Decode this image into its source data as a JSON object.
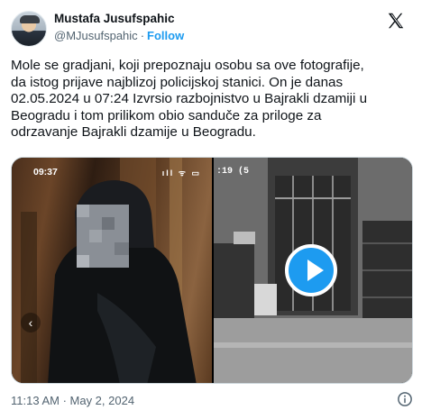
{
  "author": {
    "name": "Mustafa Jusufspahic",
    "handle": "@MJusufspahic",
    "separator": "·",
    "follow_label": "Follow"
  },
  "logo": "x-logo-icon",
  "tweet": {
    "text": "Mole se gradjani, koji prepoznaju osobu sa ove fotografije,\nda istog prijave najblizoj policijskoj stanici. On je danas\n02.05.2024 u 07:24 Izvrsio razbojnistvo u Bajrakli dzamiji u\nBeogradu i tom prilikom obio sanduče za priloge za\nodrzavanje Bajrakli dzamije u Beogradu."
  },
  "media": {
    "left_image": {
      "status_time": "09:37",
      "status_icons": "ıll ᯤ ▭",
      "nav_icon": "chevron-left-icon"
    },
    "right_image": {
      "camera_timestamp": ":19 (5",
      "play_icon": "play-icon"
    }
  },
  "footer": {
    "timestamp": "11:13 AM · May 2, 2024",
    "info_icon": "info-icon"
  },
  "colors": {
    "accent": "#1d9bf0",
    "text": "#0f1419",
    "secondary": "#536471"
  }
}
